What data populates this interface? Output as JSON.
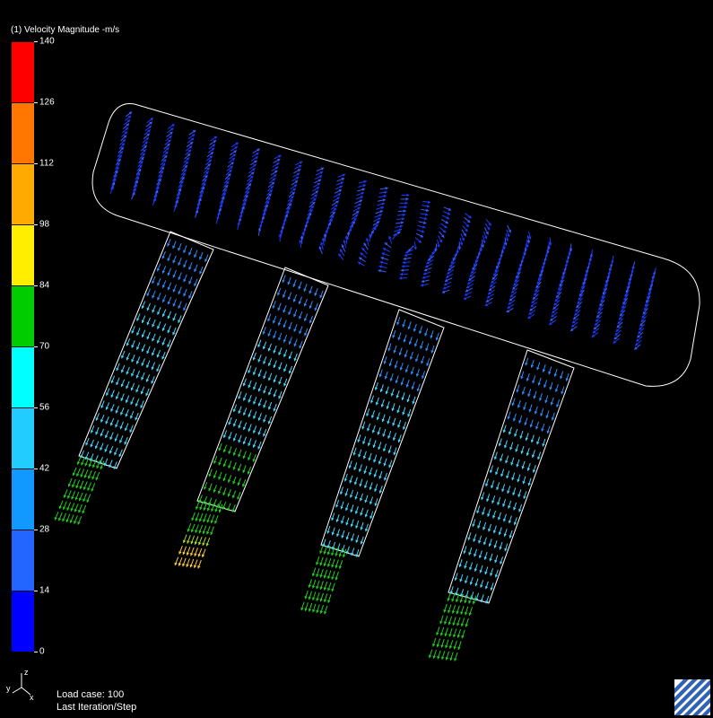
{
  "legend": {
    "title": "(1) Velocity Magnitude -m/s",
    "ticks": [
      "140",
      "126",
      "112",
      "98",
      "84",
      "70",
      "56",
      "42",
      "28",
      "14",
      "0"
    ],
    "bands": [
      "#ff0000",
      "#ff7700",
      "#ffaa00",
      "#ffee00",
      "#00cc00",
      "#00ffff",
      "#22ccff",
      "#1199ff",
      "#2266ff",
      "#0000ff"
    ]
  },
  "status": {
    "load_case": "Load case: 100",
    "step": "Last Iteration/Step"
  },
  "triad": {
    "y_label": "y",
    "z_label": "z",
    "x_label": "x"
  },
  "flow_colors": {
    "plenum": "#1a3aff",
    "plenum_light": "#3a5cff",
    "runner_top": "#2c8cff",
    "runner_mid": "#44d6ff",
    "runner_outlet": "#22cc22",
    "runner_outlet_fast": "#aadd22",
    "jet_fast": "#ffcc33",
    "outline": "#ffffff"
  },
  "icons": {
    "logo": "diagonal-stripes-logo-icon",
    "triad": "axis-triad-icon"
  }
}
